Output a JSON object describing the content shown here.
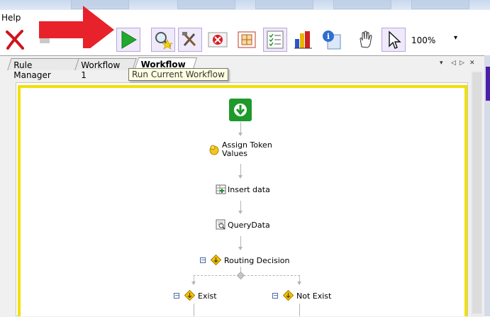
{
  "menu": {
    "help_label": "Help"
  },
  "toolbar": {
    "zoom": "100%",
    "zoom_dropdown_glyph": "▾",
    "icons": [
      "delete-icon",
      "disabled-icon",
      "run-icon",
      "find-icon",
      "tools-icon",
      "stop-icon",
      "table-icon",
      "checklist-icon",
      "chart-icon",
      "info-icon",
      "pan-hand-icon",
      "pointer-icon"
    ]
  },
  "tabs": [
    {
      "label": "Rule Manager",
      "active": false
    },
    {
      "label": "Workflow 1",
      "active": false
    },
    {
      "label": "Workflow 2",
      "active": true
    }
  ],
  "tabnav": {
    "dropdown": "▾",
    "prev": "◁",
    "next": "▷",
    "close": "✕"
  },
  "tooltip": {
    "text": "Run Current Workflow"
  },
  "workflow": {
    "assign_token_line1": "Assign Token",
    "assign_token_line2": "Values",
    "insert_data": "Insert data",
    "query_data": "QueryData",
    "routing_decision": "Routing Decision",
    "branch_exist": "Exist",
    "branch_not_exist": "Not Exist",
    "collapse_glyph": "−"
  },
  "colors": {
    "canvas_border": "#f0e000",
    "annotation_arrow": "#e8222a",
    "start_node": "#1e9a2a",
    "active_button_bg": "#efe9fa",
    "right_panel_accent": "#4b1fa8"
  }
}
